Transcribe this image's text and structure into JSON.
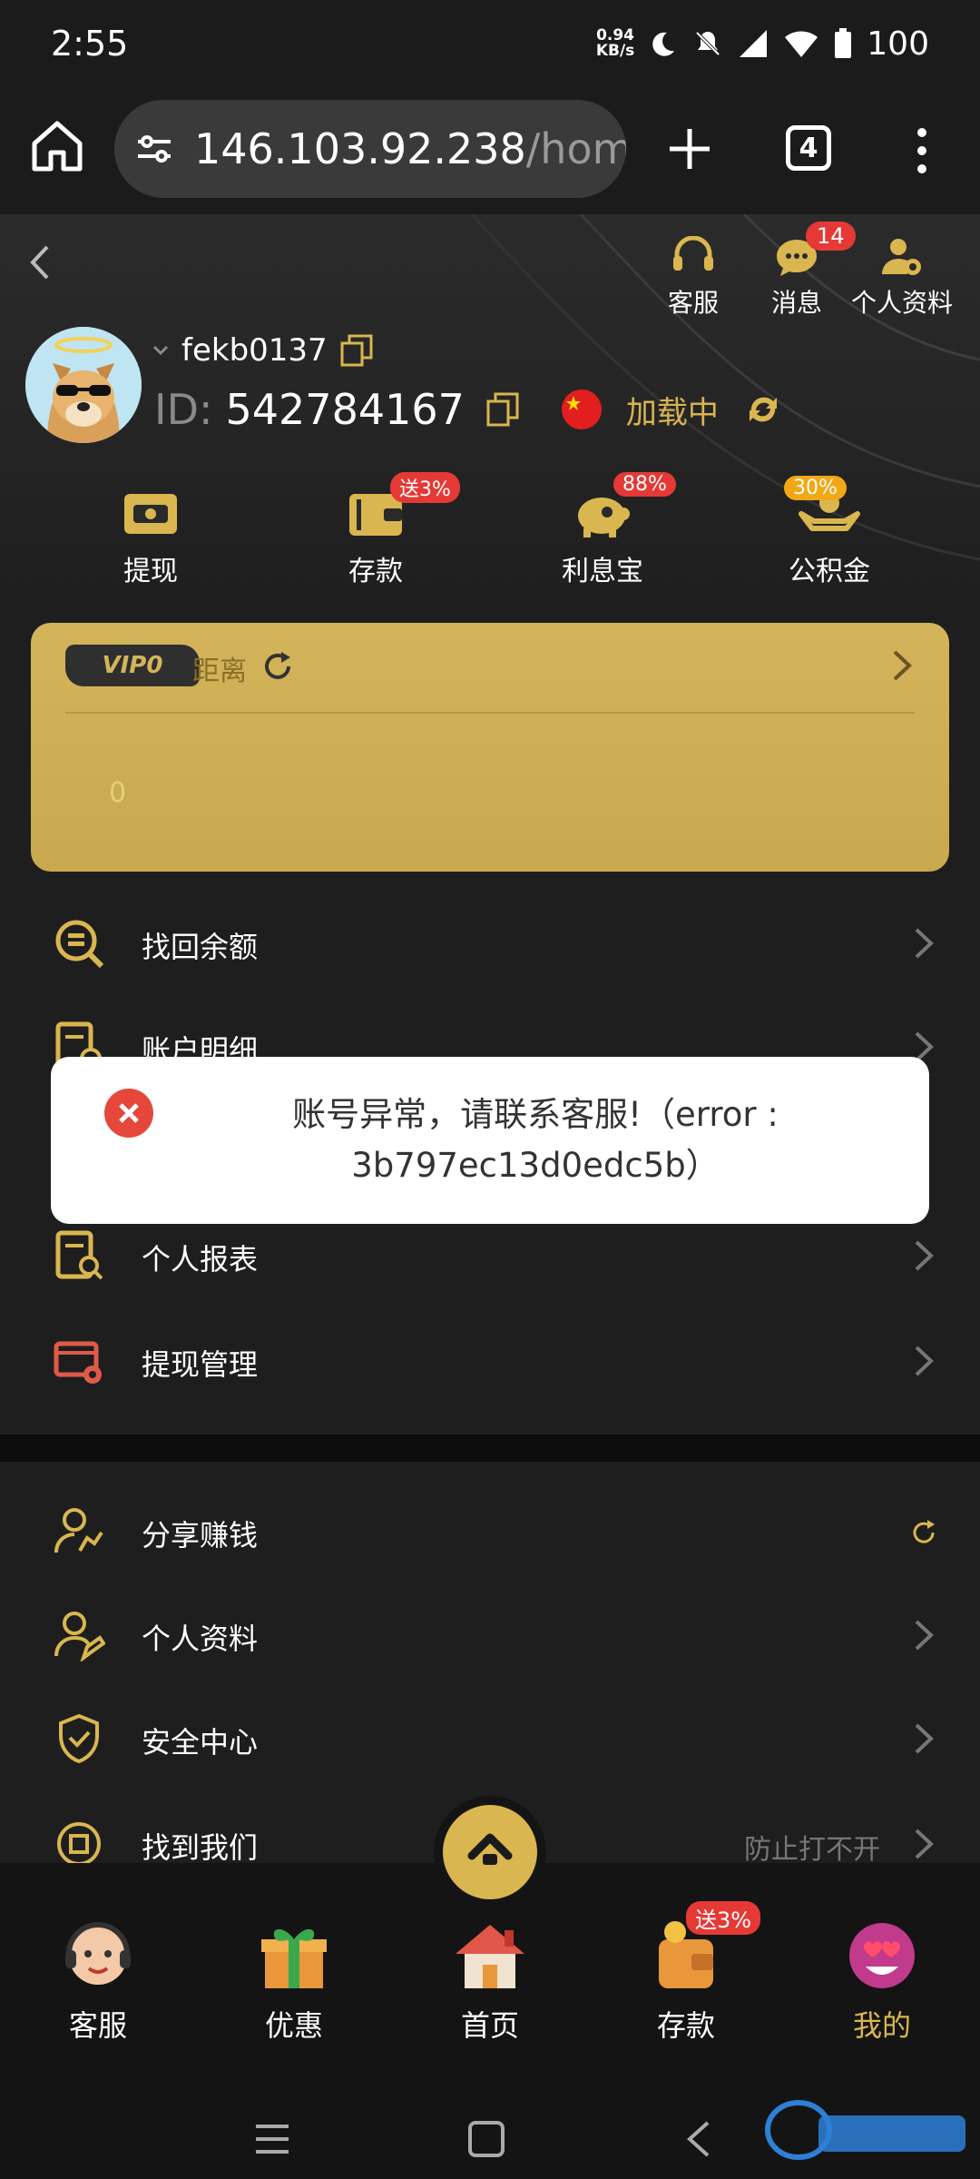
{
  "status_bar": {
    "time": "2:55",
    "net_speed_value": "0.94",
    "net_speed_unit": "KB/s",
    "battery": "100"
  },
  "browser": {
    "url_host": "146.103.92.238",
    "url_path": "/home",
    "tab_count": "4"
  },
  "header": {
    "actions": [
      {
        "label": "客服",
        "icon": "headset-icon"
      },
      {
        "label": "消息",
        "icon": "chat-icon",
        "badge": "14"
      },
      {
        "label": "个人资料",
        "icon": "profile-gear-icon"
      }
    ],
    "username": "fekb0137",
    "id_label": "ID:",
    "id_value": "542784167",
    "region_status": "加载中"
  },
  "quick_actions": [
    {
      "label": "提现",
      "icon": "withdraw-icon",
      "tag": ""
    },
    {
      "label": "存款",
      "icon": "wallet-icon",
      "tag": "送3%"
    },
    {
      "label": "利息宝",
      "icon": "piggy-bank-icon",
      "tag": "88%"
    },
    {
      "label": "公积金",
      "icon": "hand-coin-icon",
      "tag": "30%"
    }
  ],
  "vip": {
    "level": "VIP0",
    "distance_label": "距离",
    "progress_value": "0"
  },
  "menu_section_1": [
    {
      "label": "找回余额",
      "icon": "recover-balance-icon"
    },
    {
      "label": "账户明细",
      "icon": "account-detail-icon"
    },
    {
      "label": "个人报表",
      "icon": "report-icon"
    },
    {
      "label": "提现管理",
      "icon": "withdraw-manage-icon"
    }
  ],
  "menu_section_2": [
    {
      "label": "分享赚钱",
      "icon": "share-earn-icon"
    },
    {
      "label": "个人资料",
      "icon": "profile-edit-icon"
    },
    {
      "label": "安全中心",
      "icon": "shield-check-icon"
    },
    {
      "label": "找到我们",
      "icon": "find-us-icon",
      "extra": "防止打不开"
    }
  ],
  "toast": {
    "message": "账号异常，请联系客服!（error : 3b797ec13d0edc5b）"
  },
  "bottom_nav": [
    {
      "label": "客服",
      "icon": "support-agent-icon"
    },
    {
      "label": "优惠",
      "icon": "gift-icon"
    },
    {
      "label": "首页",
      "icon": "house-icon"
    },
    {
      "label": "存款",
      "icon": "deposit-wallet-icon",
      "tag": "送3%"
    },
    {
      "label": "我的",
      "icon": "heart-eyes-emoji-icon",
      "active": true
    }
  ],
  "colors": {
    "gold": "#d9b64f",
    "badge_red": "#e53935",
    "page_bg": "#1e1e1e",
    "toast_bg": "#ffffff"
  }
}
